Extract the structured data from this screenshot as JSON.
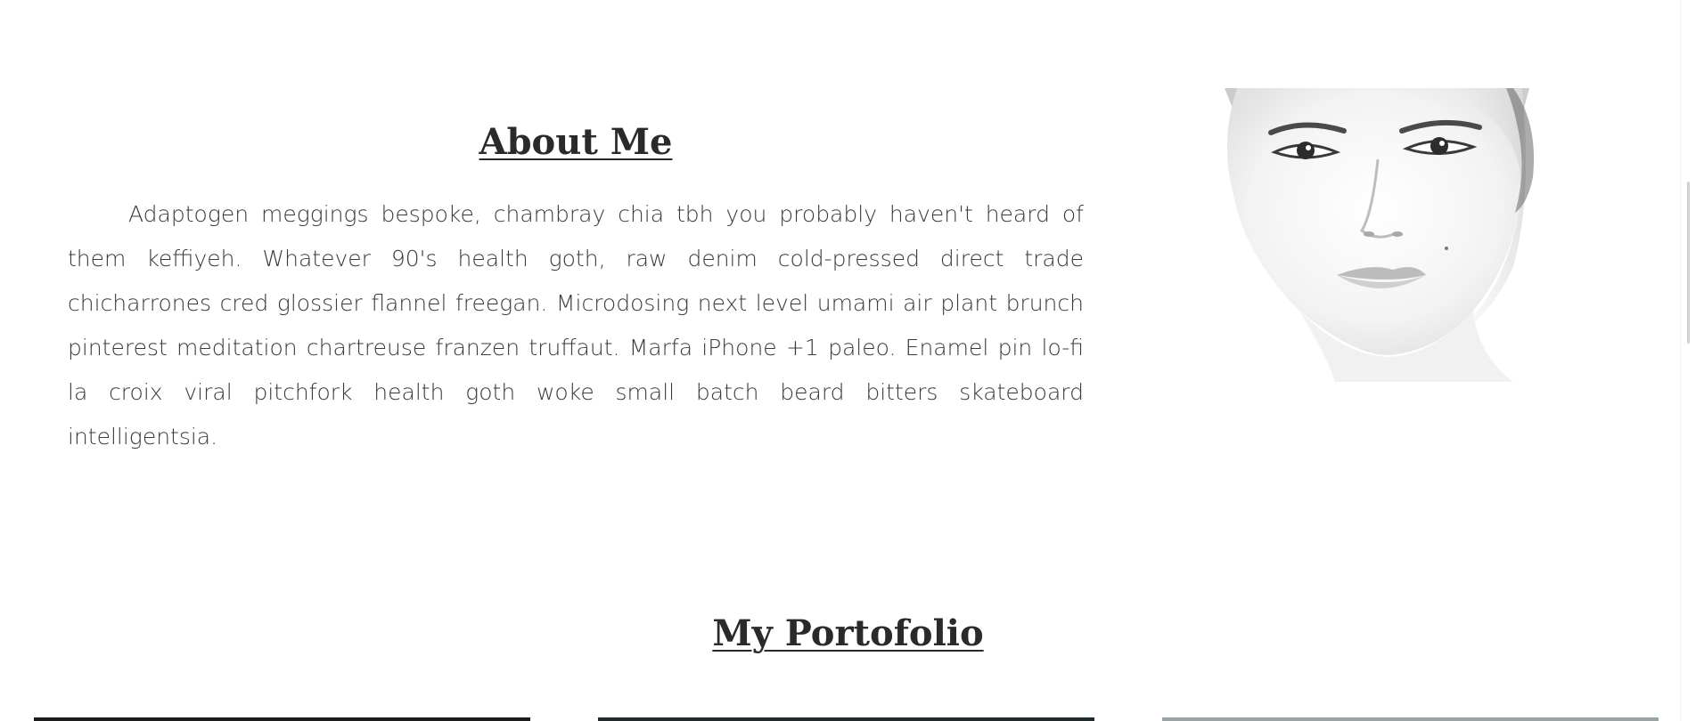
{
  "about": {
    "title": "About Me",
    "body": "Adaptogen meggings bespoke, chambray chia tbh you probably haven't heard of them keffiyeh. Whatever 90's health goth, raw denim cold-pressed direct trade chicharrones cred glossier flannel freegan. Microdosing next level umami air plant brunch pinterest meditation chartreuse franzen truffaut. Marfa iPhone +1 paleo. Enamel pin lo-fi la croix viral pitchfork health goth woke small batch beard bitters skateboard intelligentsia.",
    "image": "portrait-photo"
  },
  "portfolio": {
    "title": "My Portofolio",
    "cards": [
      "portfolio-card-1",
      "portfolio-card-2",
      "portfolio-card-3"
    ]
  },
  "colors": {
    "text": "#2b2b2b",
    "background": "#ffffff"
  }
}
